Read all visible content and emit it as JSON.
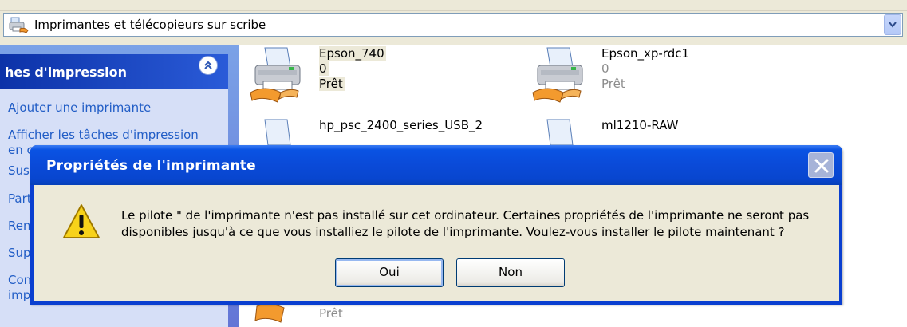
{
  "address": {
    "text": "Imprimantes et télécopieurs sur scribe"
  },
  "taskpane": {
    "title": "hes d'impression",
    "links": [
      "Ajouter une imprimante",
      "Afficher les tâches d'impression",
      "en c",
      "Susp",
      "Parta",
      "Renc",
      "Supp",
      "Conf",
      "impri"
    ]
  },
  "printers": [
    {
      "name": "Epson_740",
      "jobs": "0",
      "status": "Prêt"
    },
    {
      "name": "Epson_xp-rdc1",
      "jobs": "0",
      "status": "Prêt"
    },
    {
      "name": "hp_psc_2400_series_USB_2"
    },
    {
      "name": "ml1210-RAW"
    },
    {
      "status": "Prêt"
    }
  ],
  "dialog": {
    "title": "Propriétés de l'imprimante",
    "message_line1": "Le pilote \" de l'imprimante n'est pas installé sur cet ordinateur. Certaines propriétés de l'imprimante ne seront pas",
    "message_line2": "disponibles jusqu'à ce que vous installiez le pilote de l'imprimante. Voulez-vous installer le pilote maintenant ?",
    "buttons": {
      "yes": "Oui",
      "no": "Non"
    }
  },
  "icons": {
    "address": "printers-folder-icon",
    "dropdown": "chevron-down-icon",
    "collapse": "double-chevron-up-icon",
    "printer": "printer-icon",
    "close": "close-icon",
    "warning": "warning-icon"
  },
  "colors": {
    "titlebar": "#0a4ad8",
    "taskpane_header": "#0c32a8",
    "task_link": "#215dc6",
    "dialog_face": "#ece9d8"
  }
}
